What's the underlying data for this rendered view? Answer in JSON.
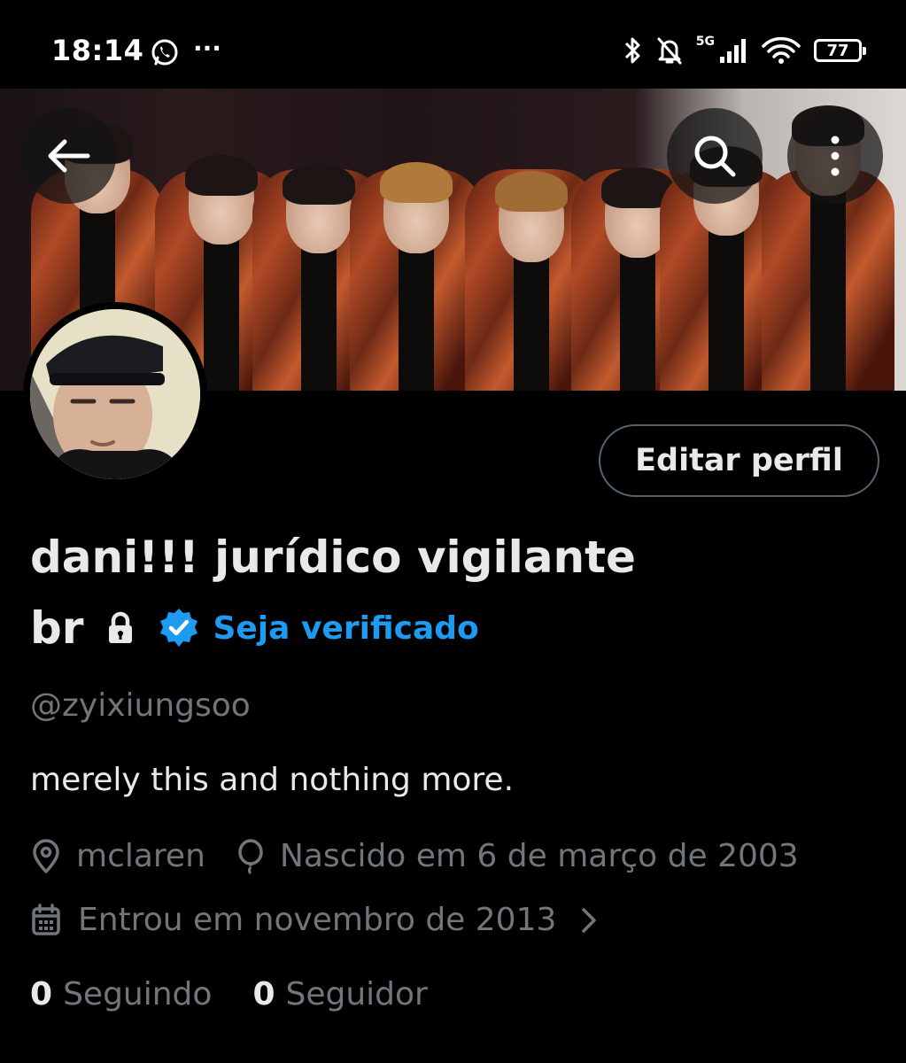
{
  "status_bar": {
    "time": "18:14",
    "more": "···",
    "network": "5G",
    "battery": "77"
  },
  "profile": {
    "display_name_line1": "dani!!! jurídico vigilante",
    "display_name_line2": "br",
    "verify_label": "Seja verificado",
    "handle": "@zyixiungsoo",
    "bio": "merely this and nothing more.",
    "location": "mclaren",
    "birthday": "Nascido em 6 de março de 2003",
    "joined": "Entrou em novembro de 2013",
    "following_count": "0",
    "following_label": "Seguindo",
    "followers_count": "0",
    "followers_label": "Seguidor",
    "edit_button": "Editar perfil"
  },
  "icons": {
    "back": "arrow-left-icon",
    "search": "search-icon",
    "more": "more-vertical-icon",
    "lock": "lock-icon",
    "verified": "verified-badge-icon",
    "location": "location-pin-icon",
    "birthday": "balloon-icon",
    "calendar": "calendar-icon",
    "chevron": "chevron-right-icon"
  },
  "colors": {
    "background": "#000000",
    "primary_text": "#e7e9ea",
    "secondary_text": "#71767b",
    "accent": "#1d9bf0",
    "border": "#536471"
  }
}
